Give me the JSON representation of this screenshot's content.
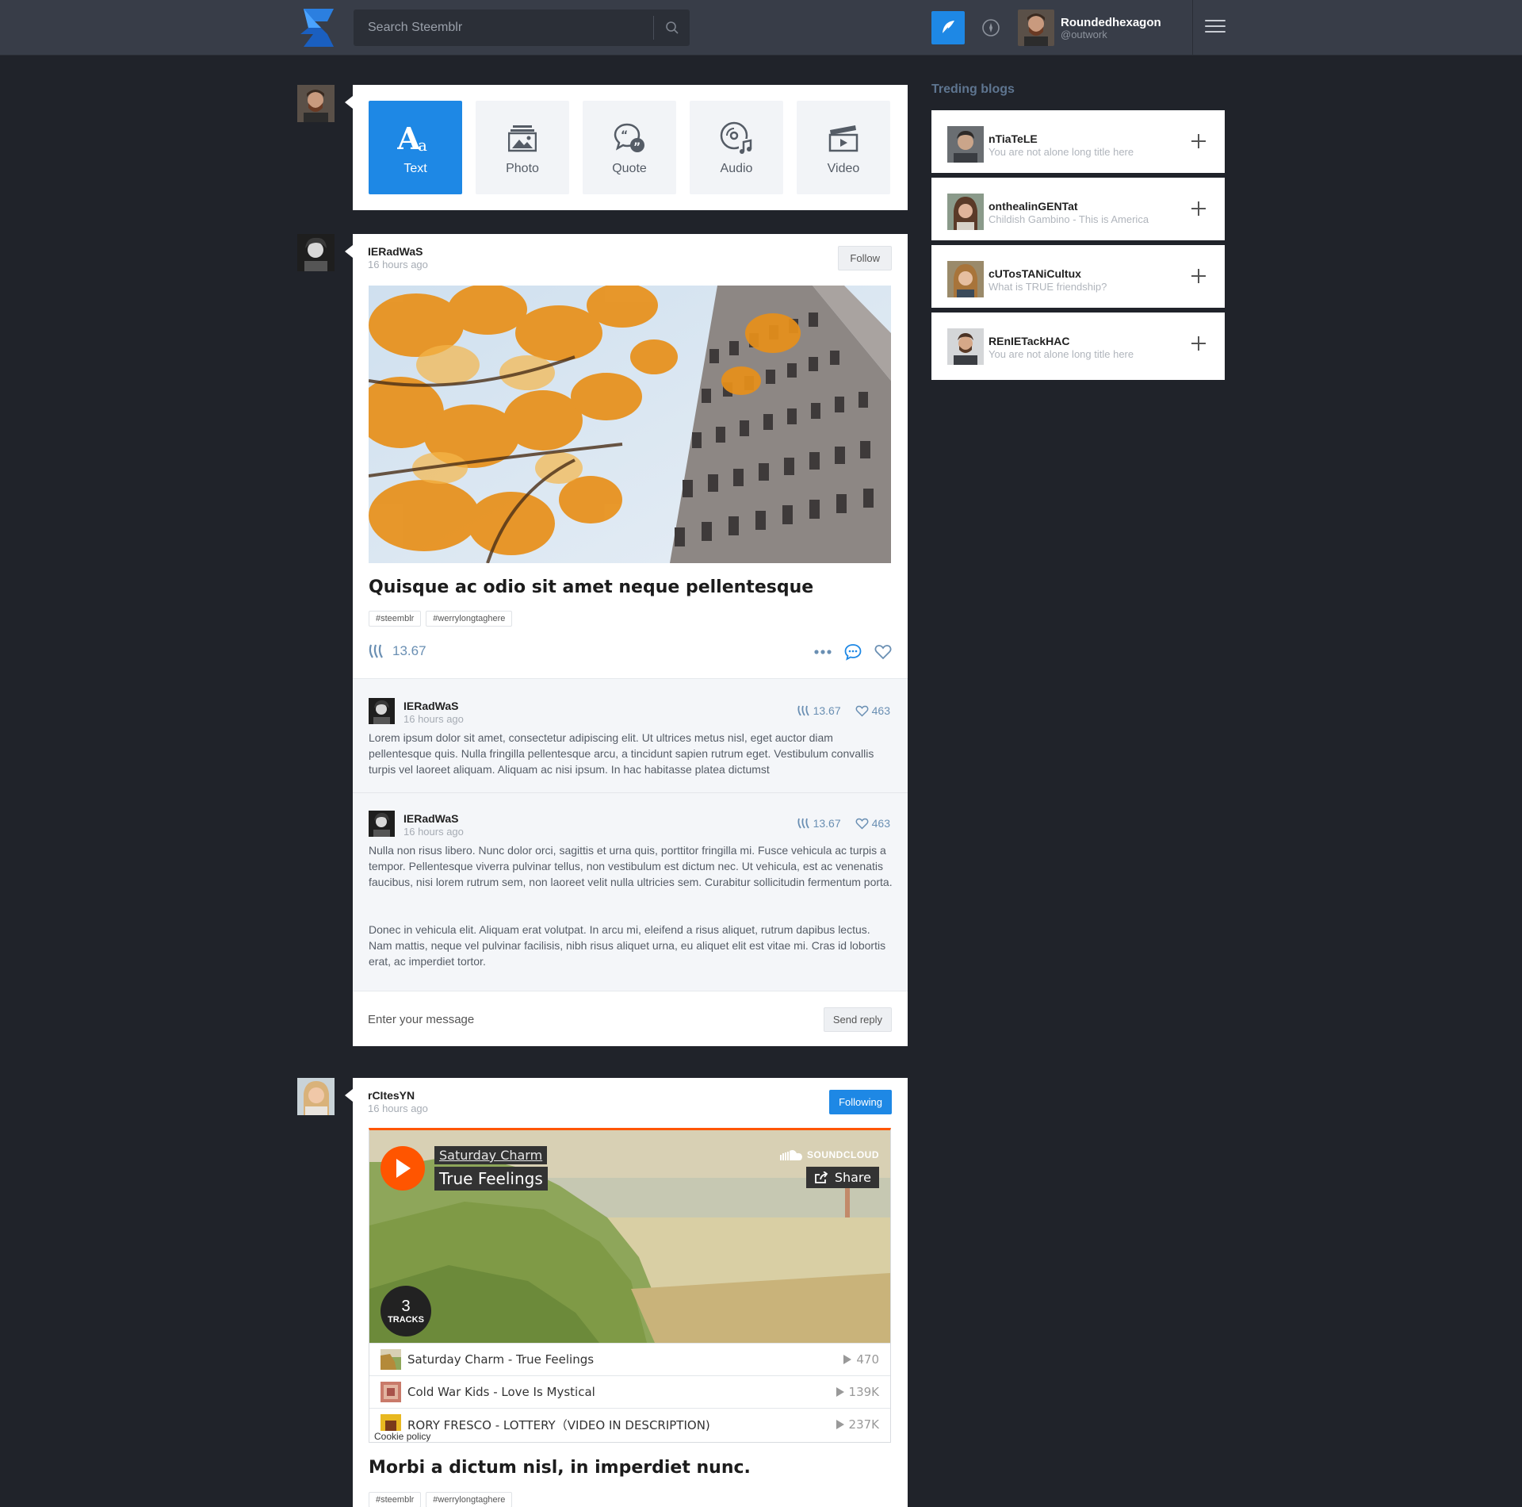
{
  "header": {
    "search_placeholder": "Search Steemblr",
    "user_name": "Roundedhexagon",
    "user_handle": "@outwork"
  },
  "composer": {
    "types": [
      {
        "label": "Text",
        "icon": "text-icon",
        "active": true
      },
      {
        "label": "Photo",
        "icon": "photo-icon",
        "active": false
      },
      {
        "label": "Quote",
        "icon": "quote-icon",
        "active": false
      },
      {
        "label": "Audio",
        "icon": "audio-icon",
        "active": false
      },
      {
        "label": "Video",
        "icon": "video-icon",
        "active": false
      }
    ]
  },
  "post1": {
    "author": "IERadWaS",
    "time": "16 hours ago",
    "follow_label": "Follow",
    "title": "Quisque ac odio sit amet neque pellentesque",
    "tags": [
      "#steemblr",
      "#werrylongtaghere"
    ],
    "value": "13.67",
    "comments": [
      {
        "author": "IERadWaS",
        "time": "16 hours ago",
        "value": "13.67",
        "likes": "463",
        "text": "Lorem ipsum dolor sit amet, consectetur adipiscing elit. Ut ultrices metus nisl, eget auctor diam pellentesque quis. Nulla fringilla pellentesque arcu, a tincidunt sapien rutrum eget. Vestibulum convallis turpis vel laoreet aliquam. Aliquam ac nisi ipsum. In hac habitasse platea dictumst"
      },
      {
        "author": "IERadWaS",
        "time": "16 hours ago",
        "value": "13.67",
        "likes": "463",
        "text": "Nulla non risus libero. Nunc dolor orci, sagittis et urna quis, porttitor fringilla mi. Fusce vehicula ac turpis a tempor. Pellentesque viverra pulvinar tellus, non vestibulum est dictum nec. Ut vehicula, est ac venenatis faucibus, nisi lorem rutrum sem, non laoreet velit nulla ultricies sem. Curabitur sollicitudin fermentum porta.",
        "text2": "Donec in vehicula elit. Aliquam erat volutpat. In arcu mi, eleifend a risus aliquet, rutrum dapibus lectus. Nam mattis, neque vel pulvinar facilisis, nibh risus aliquet urna, eu aliquet elit est vitae mi. Cras id lobortis erat, ac imperdiet tortor."
      }
    ],
    "reply_placeholder": "Enter your message",
    "send_label": "Send reply"
  },
  "post2": {
    "author": "rCItesYN",
    "time": "16 hours ago",
    "following_label": "Following",
    "soundcloud": {
      "artist": "Saturday Charm",
      "title": "True Feelings",
      "brand": "SOUNDCLOUD",
      "share_label": "Share",
      "track_count": "3",
      "tracks_label": "TRACKS",
      "tracks": [
        {
          "name": "Saturday Charm - True Feelings",
          "plays": "470"
        },
        {
          "name": "Cold War Kids - Love Is Mystical",
          "plays": "139K"
        },
        {
          "name": "RORY FRESCO - LOTTERY（VIDEO IN DESCRIPTION)",
          "plays": "237K"
        }
      ],
      "cookie_label": "Cookie policy"
    },
    "title": "Morbi a dictum nisl, in imperdiet nunc.",
    "tags": [
      "#steemblr",
      "#werrylongtaghere"
    ]
  },
  "trending": {
    "heading": "Treding blogs",
    "items": [
      {
        "name": "nTiaTeLE",
        "subtitle": "You are not alone long title here"
      },
      {
        "name": "onthealinGENTat",
        "subtitle": "Childish Gambino - This is America"
      },
      {
        "name": "cUTosTANiCultux",
        "subtitle": "What is TRUE friendship?"
      },
      {
        "name": "REnIETackHAC",
        "subtitle": "You are not alone long title here"
      }
    ]
  },
  "colors": {
    "accent": "#1e88e5",
    "background": "#20232a",
    "topbar": "#383d48",
    "soundcloud": "#ff5500"
  }
}
